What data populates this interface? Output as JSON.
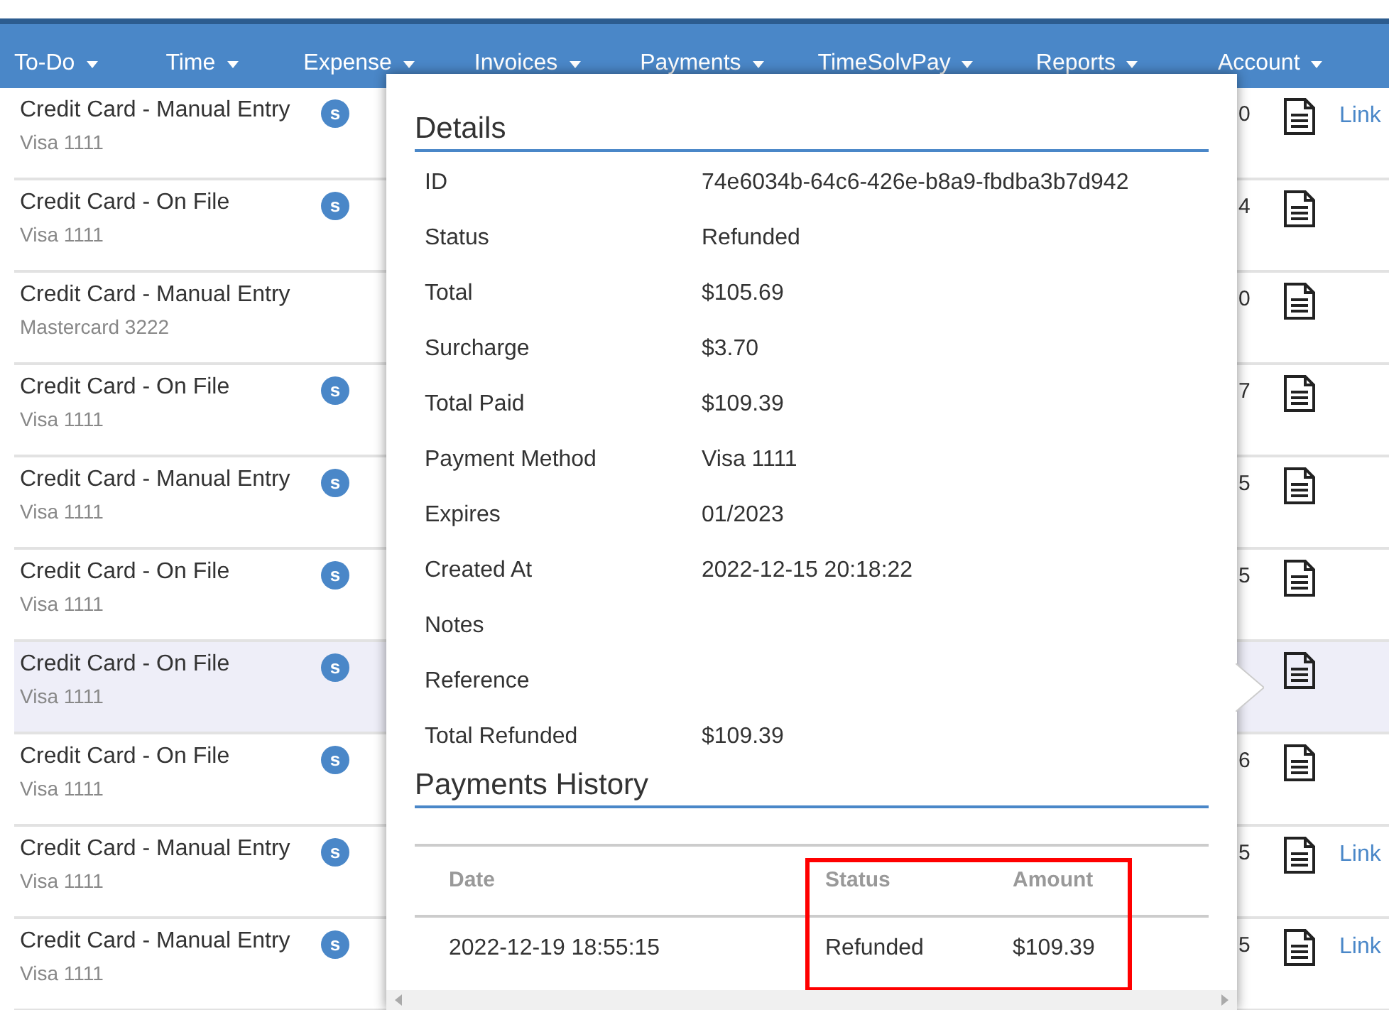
{
  "nav": [
    {
      "label": "To-Do"
    },
    {
      "label": "Time"
    },
    {
      "label": "Expense"
    },
    {
      "label": "Invoices"
    },
    {
      "label": "Payments"
    },
    {
      "label": "TimeSolvPay"
    },
    {
      "label": "Reports"
    },
    {
      "label": "Account"
    }
  ],
  "rows": [
    {
      "method": "Credit Card - Manual Entry",
      "card": "Visa 1111",
      "badge": "s",
      "amount": "0",
      "link": "Link",
      "selected": false
    },
    {
      "method": "Credit Card - On File",
      "card": "Visa 1111",
      "badge": "s",
      "amount": "4",
      "selected": false
    },
    {
      "method": "Credit Card - Manual Entry",
      "card": "Mastercard 3222",
      "amount": "0",
      "selected": false
    },
    {
      "method": "Credit Card - On File",
      "card": "Visa 1111",
      "badge": "s",
      "amount": "7",
      "selected": false
    },
    {
      "method": "Credit Card - Manual Entry",
      "card": "Visa 1111",
      "badge": "s",
      "amount": "5",
      "selected": false
    },
    {
      "method": "Credit Card - On File",
      "card": "Visa 1111",
      "badge": "s",
      "amount": "5",
      "selected": false
    },
    {
      "method": "Credit Card - On File",
      "card": "Visa 1111",
      "badge": "s",
      "selected": true
    },
    {
      "method": "Credit Card - On File",
      "card": "Visa 1111",
      "badge": "s",
      "amount": "6",
      "selected": false
    },
    {
      "method": "Credit Card - Manual Entry",
      "card": "Visa 1111",
      "badge": "s",
      "amount": "5",
      "link": "Link",
      "selected": false
    },
    {
      "method": "Credit Card - Manual Entry",
      "card": "Visa 1111",
      "badge": "s",
      "amount": "5",
      "link": "Link",
      "selected": false
    }
  ],
  "popup": {
    "details_title": "Details",
    "details": [
      {
        "label": "ID",
        "value": "74e6034b-64c6-426e-b8a9-fbdba3b7d942"
      },
      {
        "label": "Status",
        "value": "Refunded"
      },
      {
        "label": "Total",
        "value": "$105.69"
      },
      {
        "label": "Surcharge",
        "value": "$3.70"
      },
      {
        "label": "Total Paid",
        "value": "$109.39"
      },
      {
        "label": "Payment Method",
        "value": "Visa 1111"
      },
      {
        "label": "Expires",
        "value": "01/2023"
      },
      {
        "label": "Created At",
        "value": "2022-12-15 20:18:22"
      },
      {
        "label": "Notes"
      },
      {
        "label": "Reference"
      },
      {
        "label": "Total Refunded",
        "value": "$109.39"
      }
    ],
    "history_title": "Payments History",
    "history": {
      "columns": [
        "Date",
        "Status",
        "Amount"
      ],
      "rows": [
        [
          "2022-12-19 18:55:15",
          "Refunded",
          "$109.39"
        ]
      ]
    }
  }
}
